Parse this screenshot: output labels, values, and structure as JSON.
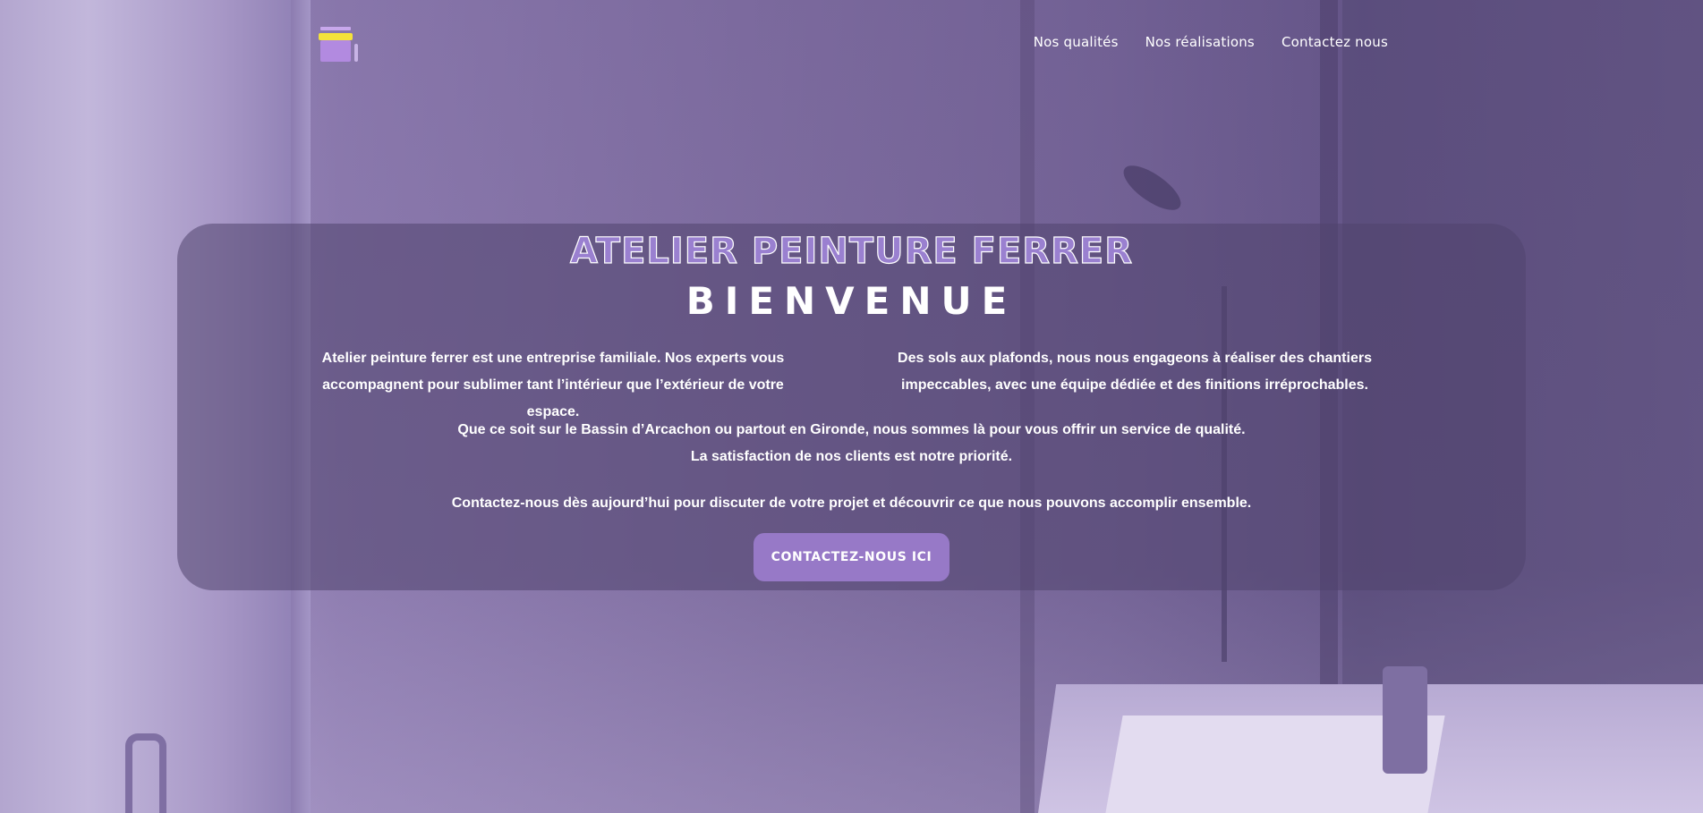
{
  "nav": {
    "items": [
      {
        "label": "Nos qualités"
      },
      {
        "label": "Nos réalisations"
      },
      {
        "label": "Contactez nous"
      }
    ]
  },
  "hero": {
    "title": "ATELIER PEINTURE FERRER",
    "subtitle": "BIENVENUE",
    "left_paragraph": "Atelier peinture ferrer est une entreprise familiale. Nos experts vous accompagnent pour sublimer tant l’intérieur que l’extérieur de votre espace.",
    "right_paragraph": "Des sols aux plafonds, nous nous engageons à réaliser des chantiers impeccables, avec une équipe dédiée et des finitions irréprochables.",
    "region_line1": "Que ce soit sur le Bassin d’Arcachon ou partout en Gironde, nous sommes là pour vous offrir un service de qualité.",
    "region_line2": "La satisfaction de nos clients est notre priorité.",
    "contact_line": "Contactez-nous dès aujourd’hui pour discuter de votre projet et découvrir ce que nous pouvons accomplir ensemble.",
    "cta_label": "CONTACTEZ-NOUS ICI"
  },
  "colors": {
    "accent": "#9779c7",
    "title_fill": "#9a80d0",
    "overlay": "#50446e"
  }
}
